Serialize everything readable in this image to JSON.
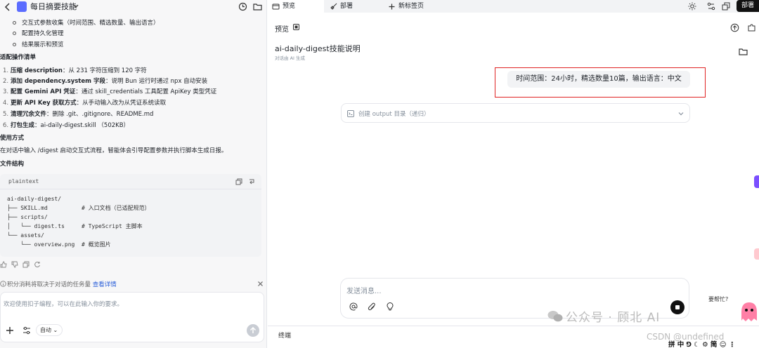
{
  "left": {
    "title": "每日摘要技能",
    "top_bullets": [
      "交互式参数收集（时间范围、精选数量、输出语言）",
      "配置持久化管理",
      "结果展示和预览"
    ],
    "section_changes": "适配操作清单",
    "changes": [
      {
        "n": "1.",
        "bold": "压缩 description",
        "rest": "：从 231 字符压缩到 120 字符"
      },
      {
        "n": "2.",
        "bold": "添加 dependency.system 字段",
        "rest": "：说明 Bun 运行时通过 npx 自动安装"
      },
      {
        "n": "3.",
        "bold": "配置 Gemini API 凭证",
        "rest": "：通过 skill_credentials 工具配置 ApiKey 类型凭证"
      },
      {
        "n": "4.",
        "bold": "更新 API Key 获取方式",
        "rest": "：从手动输入改为从凭证系统读取"
      },
      {
        "n": "5.",
        "bold": "清理冗余文件",
        "rest": "：删除 .git、.gitignore、README.md"
      },
      {
        "n": "6.",
        "bold": "打包生成",
        "rest": "：ai-daily-digest.skill （502KB）"
      }
    ],
    "section_usage": "使用方式",
    "usage": "在对话中输入 /digest 启动交互式流程，智能体会引导配置参数并执行脚本生成日报。",
    "section_structure": "文件结构",
    "code_lang": "plaintext",
    "code_lines": [
      "ai-daily-digest/",
      "├── SKILL.md          # 入口文档（已适配规范）",
      "├── scripts/",
      "│   └── digest.ts     # TypeScript 主脚本",
      "└── assets/",
      "    └── overview.png  # 概览图片"
    ],
    "note": "积分消耗将取决于对话的任务量",
    "note_link": "查看详情",
    "input_placeholder": "欢迎使用扣子编程，可以在此输入你的要求。",
    "mode": "自动"
  },
  "right": {
    "tabs": [
      "预览",
      "部署",
      "新标签页"
    ],
    "deploy": "部署",
    "preview_label": "预览",
    "doc_title": "ai-daily-digest技能说明",
    "doc_sub": "对话由 AI 生成",
    "user_msg": "时间范围：24小时，精选数量10篇，输出语言：中文",
    "step": "创建 output 目录（递归）",
    "chat_placeholder": "发送消息...",
    "help": "要帮忙?",
    "terminal": "终端",
    "watermark": "公众号 · 顾北 AI",
    "watermark2": "CSDN @undefined",
    "ime": "拼 中 ⅁ ☾ ⚙ 简 ☺ ⋮"
  }
}
